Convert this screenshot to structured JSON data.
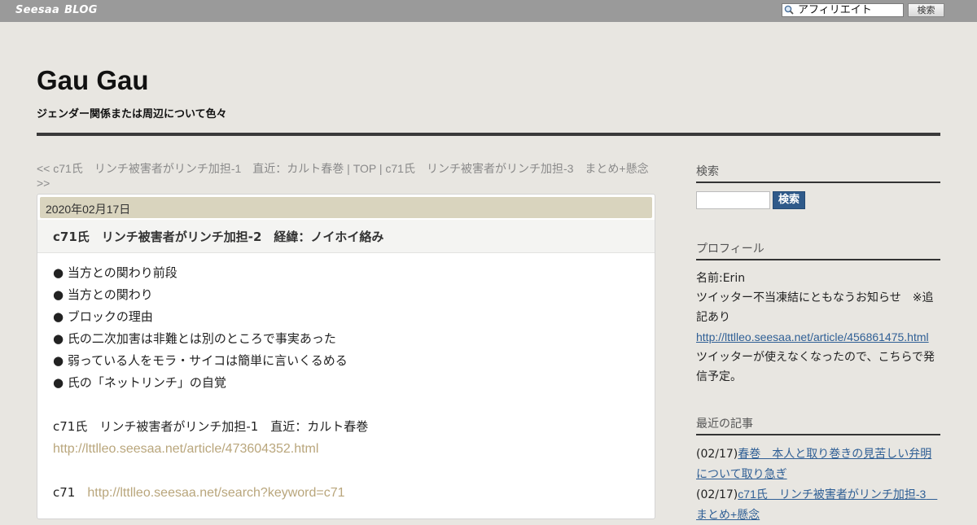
{
  "topbar": {
    "logo_brand": "Seesaa",
    "logo_blog": "BLOG",
    "search_value": "アフィリエイト",
    "search_button": "検索"
  },
  "header": {
    "title": "Gau Gau",
    "description": "ジェンダー関係または周辺について色々"
  },
  "nav": {
    "prev": "<< c71氏　リンチ被害者がリンチ加担-1　直近：カルト春巻",
    "sep1": " | ",
    "top": "TOP",
    "sep2": " | ",
    "next": "c71氏　リンチ被害者がリンチ加担-3　まとめ+懸念 >>"
  },
  "article": {
    "date": "2020年02月17日",
    "title": "c71氏　リンチ被害者がリンチ加担-2　経緯：ノイホイ絡み",
    "bullets": [
      "● 当方との関わり前段",
      "● 当方との関わり",
      "● ブロックの理由",
      "● 氏の二次加害は非難とは別のところで事実あった",
      "● 弱っている人をモラ・サイコは簡単に言いくるめる",
      "● 氏の「ネットリンチ」の自覚"
    ],
    "ref1_text": "c71氏　リンチ被害者がリンチ加担-1　直近：カルト春巻",
    "ref1_link": "http://lttlleo.seesaa.net/article/473604352.html",
    "ref2_label": "c71　",
    "ref2_link": "http://lttlleo.seesaa.net/search?keyword=c71"
  },
  "sidebar": {
    "search_heading": "検索",
    "search_button": "検索",
    "profile_heading": "プロフィール",
    "profile_name": "名前:Erin",
    "profile_notice": "ツイッター不当凍結にともなうお知らせ　※追記あり",
    "profile_link": "http://lttlleo.seesaa.net/article/456861475.html",
    "profile_note": "ツイッターが使えなくなったので、こちらで発信予定。",
    "recent_heading": "最近の記事",
    "recent": [
      {
        "date": "(02/17)",
        "title": "春巻　本人と取り巻きの見苦しい弁明について取り急ぎ"
      },
      {
        "date": "(02/17)",
        "title": "c71氏　リンチ被害者がリンチ加担-3　まとめ+懸念"
      }
    ]
  }
}
